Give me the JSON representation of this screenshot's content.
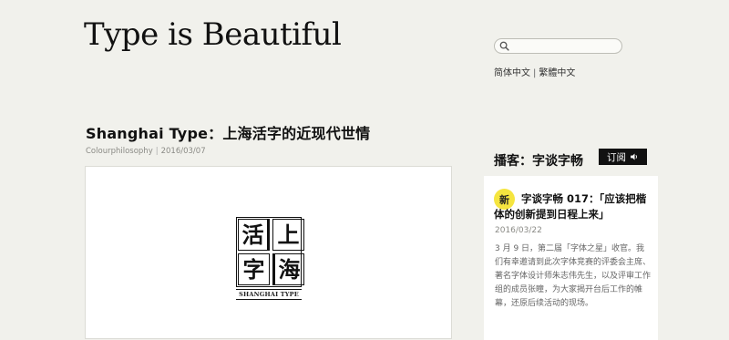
{
  "site": {
    "title": "Type is Beautiful"
  },
  "search": {
    "placeholder": "",
    "value": ""
  },
  "language": {
    "simplified": "简体中文",
    "separator": "|",
    "traditional": "繁體中文"
  },
  "post": {
    "title": "Shanghai Type：上海活字的近现代世情",
    "category": "Colourphilosophy",
    "meta_separator": "|",
    "date": "2016/03/07",
    "logo": {
      "chars": [
        "活",
        "上",
        "字",
        "海"
      ],
      "caption": "SHANGHAI TYPE"
    }
  },
  "sidebar": {
    "title": "播客：字谈字畅",
    "subscribe_label": "订阅",
    "episode": {
      "badge": "新",
      "title": "字谈字畅 017：「应该把楷体的创新提到日程上来」",
      "date": "2016/03/22",
      "description": "3 月 9 日，第二届「字体之星」收官。我们有幸邀请到此次字体竞赛的评委会主席、著名字体设计师朱志伟先生，以及评审工作组的成员张瞳，为大家揭开台后工作的帷幕，还原后续活动的现场。"
    }
  },
  "icons": {
    "search": "search-icon",
    "subscribe": "speaker-icon"
  },
  "colors": {
    "background": "#f1f1ec",
    "badge": "#f5e53f",
    "button": "#111111"
  }
}
